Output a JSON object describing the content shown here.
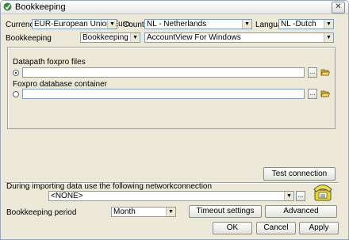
{
  "window": {
    "title": "Bookkeeping",
    "close_symbol": "✕"
  },
  "fields": {
    "currency": {
      "label": "Currency",
      "value": "EUR-European Union Euro"
    },
    "country": {
      "label": "Country",
      "value": "NL - Netherlands"
    },
    "language": {
      "label": "Language",
      "value": "NL -Dutch"
    },
    "bookkeeping": {
      "label": "Bookkeeping",
      "value": "Bookkeeping",
      "package": "AccountView For Windows"
    }
  },
  "paths": {
    "datapath": {
      "label": "Datapath foxpro files",
      "value": "",
      "selected": true
    },
    "container": {
      "label": "Foxpro database container",
      "value": "",
      "selected": false
    },
    "browse_label": "..."
  },
  "test_connection_label": "Test connection",
  "network": {
    "label": "During importing data use the following networkconnection",
    "value": "<NONE>",
    "browse_label": "..."
  },
  "period": {
    "label": "Bookkeeping period",
    "value": "Month"
  },
  "buttons": {
    "timeout": "Timeout settings",
    "advanced": "Advanced",
    "ok": "OK",
    "cancel": "Cancel",
    "apply": "Apply"
  },
  "icons": {
    "title": "bookkeeping-app-icon",
    "folder": "open-folder-icon",
    "network": "network-phone-icon"
  }
}
